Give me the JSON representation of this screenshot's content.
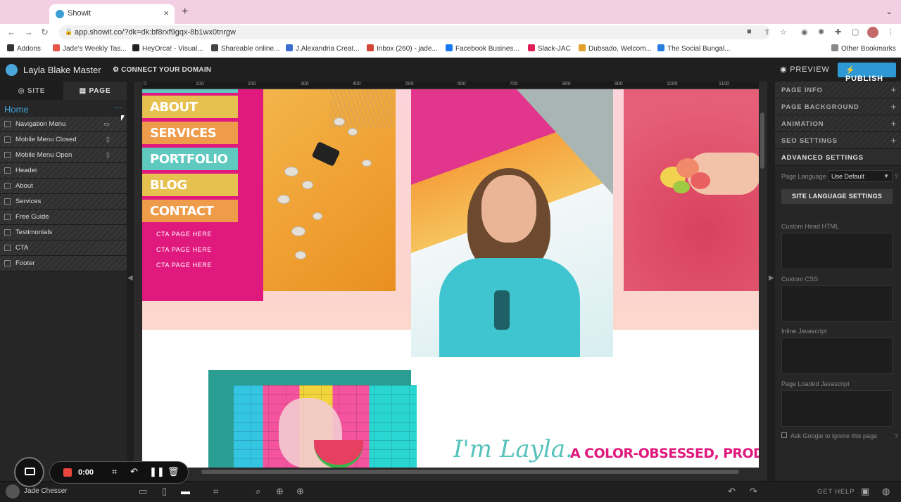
{
  "browser": {
    "tab_title": "Showit",
    "url": "app.showit.co/?dk=dk:bf8rxf9gqx-8b1wx0tnrgw",
    "bookmarks": [
      "Addons",
      "Jade's Weekly Tas...",
      "HeyOrca! - Visual...",
      "Shareable online...",
      "J.Alexandria Creat...",
      "Inbox (260) - jade...",
      "Facebook Busines...",
      "Slack-JAC",
      "Dubsado, Welcom...",
      "The Social Bungal...",
      "Other Bookmarks"
    ]
  },
  "app": {
    "site_name": "Layla Blake Master",
    "connect_domain": "CONNECT YOUR DOMAIN",
    "preview": "PREVIEW",
    "publish": "PUBLISH"
  },
  "left_panel": {
    "tab_site": "SITE",
    "tab_page": "PAGE",
    "page_name": "Home",
    "sections": [
      "Navigation Menu",
      "Mobile Menu Closed",
      "Mobile Menu Open",
      "Header",
      "About",
      "Services",
      "Free Guide",
      "Testimonials",
      "CTA",
      "Footer"
    ]
  },
  "ruler": [
    "0",
    "100",
    "200",
    "300",
    "400",
    "500",
    "600",
    "700",
    "800",
    "900",
    "1000",
    "1100"
  ],
  "canvas": {
    "nav_items": [
      "ABOUT",
      "SERVICES",
      "PORTFOLIO",
      "BLOG",
      "CONTACT"
    ],
    "nav_colors": [
      "#e6c14f",
      "#ee9b4a",
      "#5fc9c0",
      "#e6c14f",
      "#ee9b4a"
    ],
    "cta_links": [
      "CTA PAGE HERE",
      "CTA PAGE HERE",
      "CTA PAGE HERE"
    ],
    "greeting": "I'm Layla.",
    "tagline": "A COLOR-OBSESSED, PRODUCT"
  },
  "right_panel": {
    "rows": [
      "PAGE INFO",
      "PAGE BACKGROUND",
      "ANIMATION",
      "SEO SETTINGS"
    ],
    "advanced": "ADVANCED SETTINGS",
    "page_language_label": "Page Language",
    "page_language_value": "Use Default",
    "site_language_button": "SITE LANGUAGE SETTINGS",
    "custom_head": "Custom Head HTML",
    "custom_css": "Custom CSS",
    "inline_js": "Inline Javascript",
    "page_loaded_js": "Page Loaded Javascript",
    "ask_google": "Ask Google to ignore this page"
  },
  "bottom": {
    "user": "Jade Chesser",
    "get_help": "GET HELP"
  },
  "recorder": {
    "time": "0:00"
  }
}
